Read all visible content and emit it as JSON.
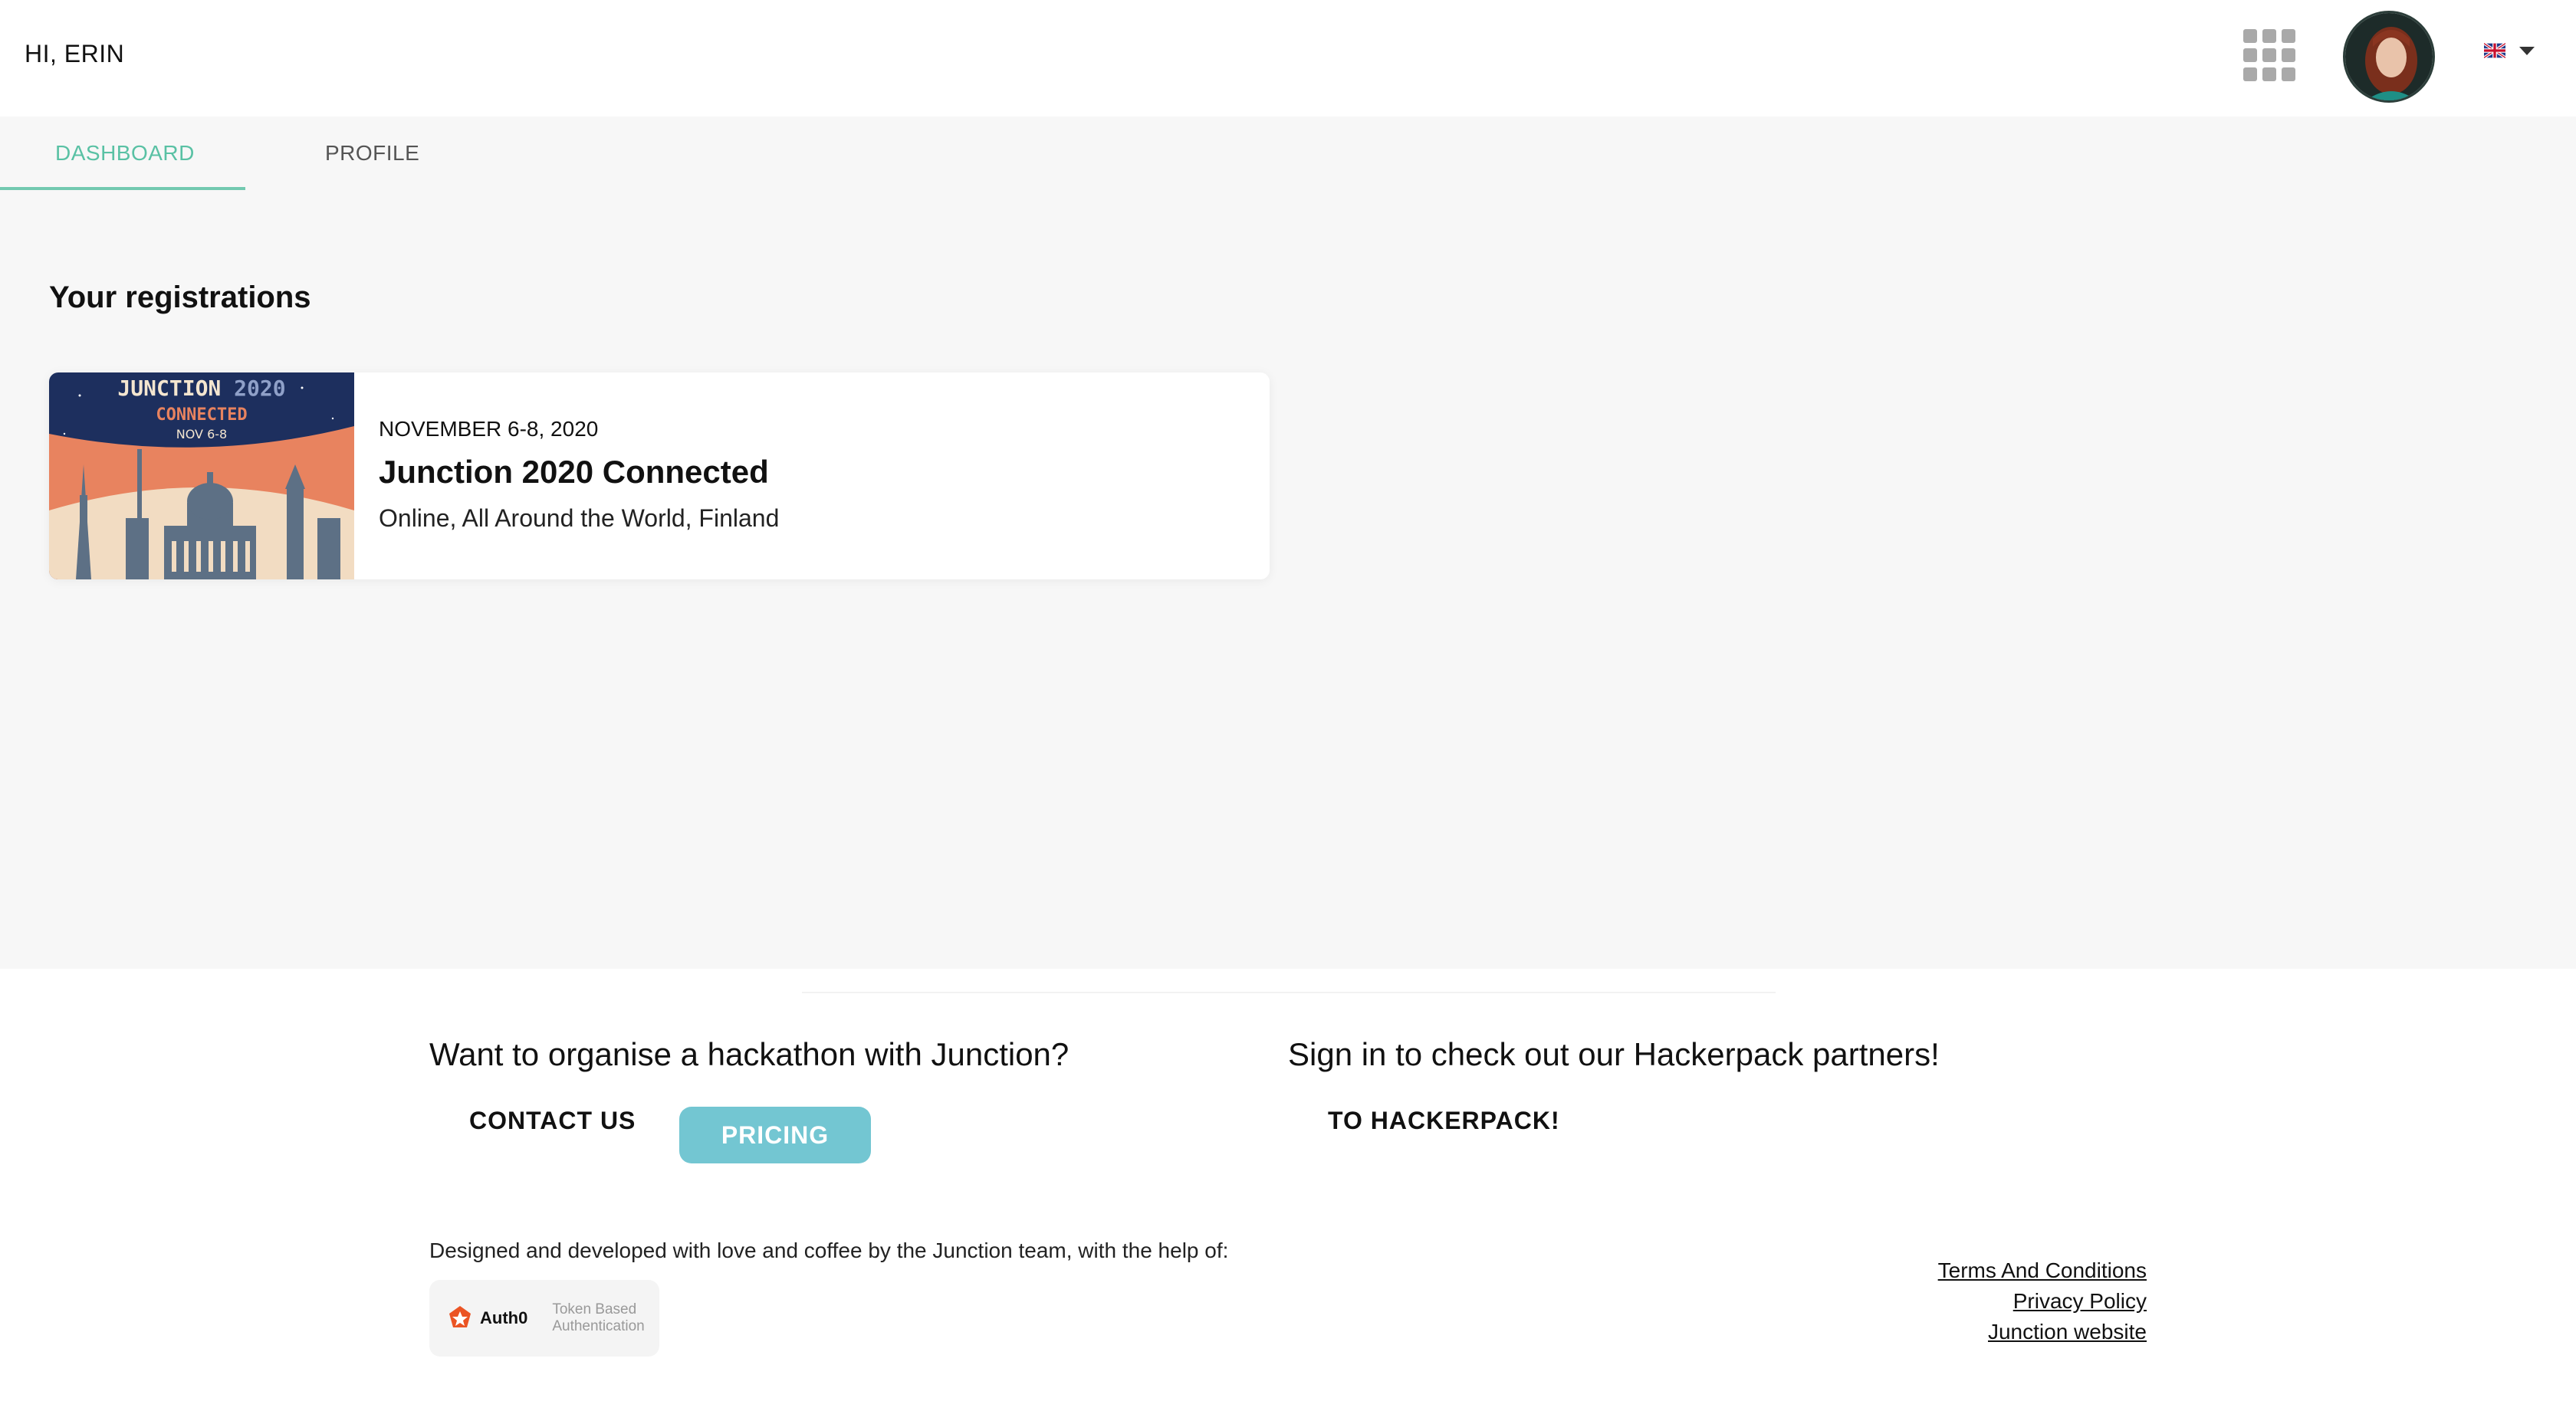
{
  "header": {
    "greeting": "HI, ERIN",
    "apps_icon": "grid-apps-icon",
    "avatar_alt": "user-avatar",
    "language": {
      "selected": "en-GB",
      "flag_icon": "uk-flag-icon"
    }
  },
  "tabs": [
    {
      "label": "DASHBOARD",
      "active": true
    },
    {
      "label": "PROFILE",
      "active": false
    }
  ],
  "main": {
    "section_title": "Your registrations",
    "registrations": [
      {
        "image_text": {
          "line1": "JUNCTION",
          "line1b": "2020",
          "line2": "CONNECTED",
          "line3": "NOV 6-8"
        },
        "date": "NOVEMBER 6-8, 2020",
        "title": "Junction 2020 Connected",
        "location": "Online, All Around the World, Finland"
      }
    ]
  },
  "footer": {
    "organise_heading": "Want to organise a hackathon with Junction?",
    "contact_label": "CONTACT US",
    "pricing_label": "PRICING",
    "hackerpack_heading": "Sign in to check out our Hackerpack partners!",
    "hackerpack_label": "TO HACKERPACK!",
    "credit": "Designed and developed with love and coffee by the Junction team, with the help of:",
    "auth0": {
      "name": "Auth0",
      "sub1": "Token Based",
      "sub2": "Authentication"
    },
    "links": [
      "Terms And Conditions",
      "Privacy Policy",
      "Junction website"
    ]
  },
  "colors": {
    "accent_green": "#59c1a4",
    "pricing_bg": "#73c6d2",
    "page_bg": "#f7f7f7"
  }
}
